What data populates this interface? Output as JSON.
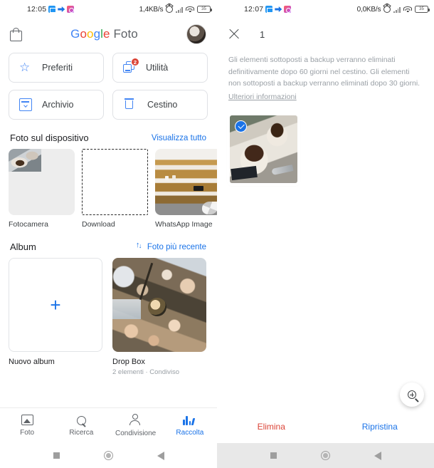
{
  "left_screen": {
    "status_bar": {
      "time": "12:05",
      "app_icons": [
        "mail-icon",
        "messenger-icon",
        "photos-icon"
      ],
      "network_speed": "1,4KB/s",
      "indicator_icons": [
        "alarm-icon",
        "signal-icon",
        "wifi-icon"
      ],
      "battery_level": "35"
    },
    "app_bar": {
      "store_icon": "shopping-bag-icon",
      "brand": {
        "g1": "G",
        "g2": "o",
        "g3": "o",
        "g4": "g",
        "g5": "l",
        "g6": "e",
        "product": "Foto"
      },
      "avatar": "user-avatar"
    },
    "tiles": [
      {
        "label": "Preferiti",
        "icon": "star-icon",
        "badge": null
      },
      {
        "label": "Utilità",
        "icon": "utility-icon",
        "badge": "2"
      },
      {
        "label": "Archivio",
        "icon": "archive-icon",
        "badge": null
      },
      {
        "label": "Cestino",
        "icon": "trash-icon",
        "badge": null
      }
    ],
    "device_photos": {
      "title": "Foto sul dispositivo",
      "action": "Visualizza tutto",
      "items": [
        {
          "label": "Fotocamera",
          "thumb": "dessert-partial-thumb"
        },
        {
          "label": "Download",
          "thumb": "empty-dashed-placeholder"
        },
        {
          "label": "WhatsApp Image",
          "thumb": "cafe-shelves-thumb"
        }
      ]
    },
    "albums": {
      "title": "Album",
      "action": "Foto più recente",
      "action_icon": "sort-icon",
      "items": [
        {
          "label": "Nuovo album",
          "subtitle": "",
          "thumb": "plus-icon"
        },
        {
          "label": "Drop Box",
          "subtitle": "2 elementi  ·  Condiviso",
          "thumb": "anime-collage-thumb"
        }
      ]
    },
    "bottom_nav": [
      {
        "label": "Foto",
        "icon": "photo-icon",
        "active": false
      },
      {
        "label": "Ricerca",
        "icon": "search-icon",
        "active": false
      },
      {
        "label": "Condivisione",
        "icon": "share-icon",
        "active": false
      },
      {
        "label": "Raccolta",
        "icon": "library-icon",
        "active": true
      }
    ],
    "android_nav": [
      "recents-square-icon",
      "home-circle-icon",
      "back-triangle-icon"
    ]
  },
  "right_screen": {
    "status_bar": {
      "time": "12:07",
      "app_icons": [
        "mail-icon",
        "messenger-icon",
        "photos-icon"
      ],
      "network_speed": "0,0KB/s",
      "indicator_icons": [
        "alarm-icon",
        "signal-icon",
        "wifi-icon"
      ],
      "battery_level": "35"
    },
    "selection_bar": {
      "close_icon": "close-icon",
      "count": "1"
    },
    "notice": {
      "text": "Gli elementi sottoposti a backup verranno eliminati definitivamente dopo 60 giorni nel cestino. Gli elementi non sottoposti a backup verranno eliminati dopo 30 giorni.",
      "link": "Ulteriori informazioni"
    },
    "selected_items": [
      {
        "thumb": "tiramisu-dessert-thumb",
        "selected": true,
        "check_icon": "check-circle-icon"
      }
    ],
    "zoom_fab": "zoom-in-icon",
    "actions": [
      {
        "label": "Elimina",
        "role": "delete",
        "color": "#DB4437"
      },
      {
        "label": "Ripristina",
        "role": "restore",
        "color": "#1a73e8"
      }
    ],
    "android_nav": [
      "recents-square-icon",
      "home-circle-icon",
      "back-triangle-icon"
    ]
  }
}
